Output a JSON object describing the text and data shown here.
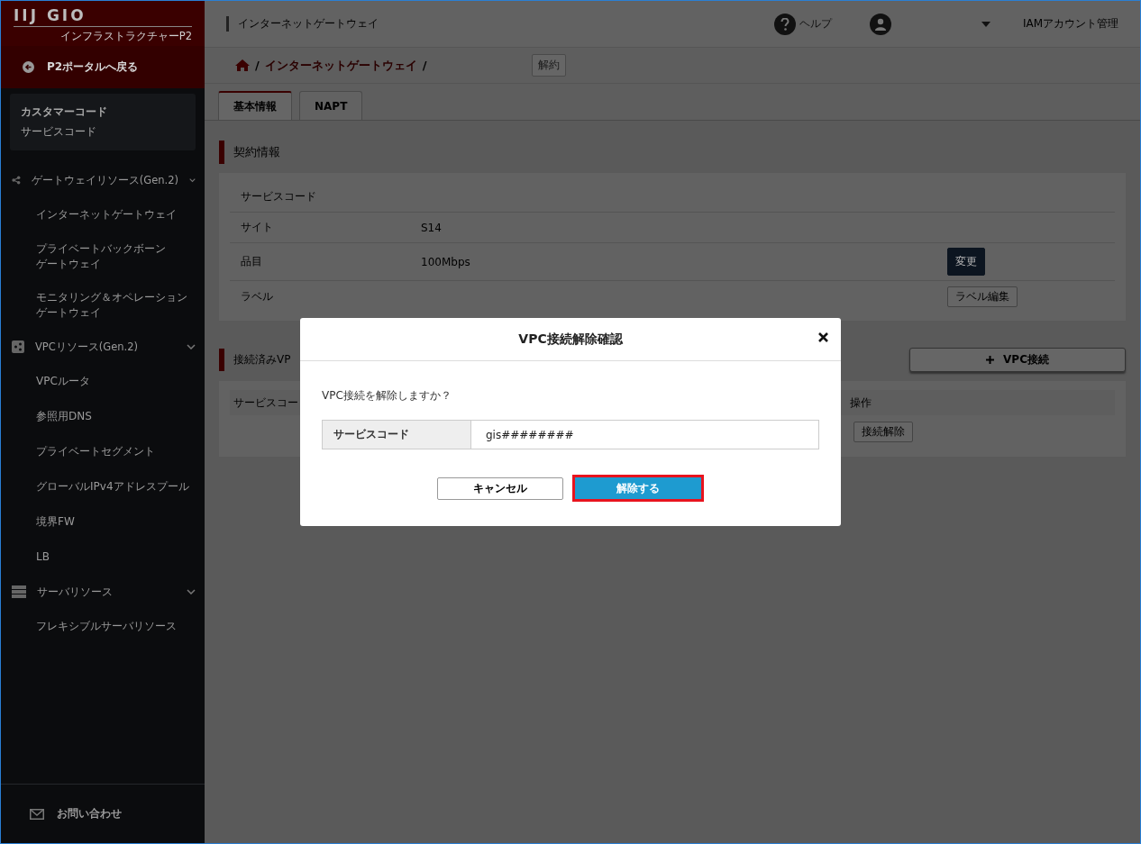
{
  "sidebar": {
    "logo": "IIJ GIO",
    "subtitle": "インフラストラクチャーP2",
    "back_link": "P2ポータルへ戻る",
    "customer": [
      "カスタマーコード",
      "サービスコード"
    ],
    "groups": [
      {
        "label": "ゲートウェイリソース(Gen.2)",
        "kind": "share",
        "expanded": true,
        "children": [
          [
            "インターネットゲートウェイ"
          ],
          [
            "プライベートバックボーン",
            "ゲートウェイ"
          ],
          [
            "モニタリング＆オペレーション",
            "ゲートウェイ"
          ]
        ]
      },
      {
        "label": "VPCリソース(Gen.2)",
        "kind": "share-square",
        "expanded": true,
        "children": [
          [
            "VPCルータ"
          ],
          [
            "参照用DNS"
          ],
          [
            "プライベートセグメント"
          ],
          [
            "グローバルIPv4アドレスプール"
          ],
          [
            "境界FW"
          ],
          [
            "LB"
          ]
        ]
      },
      {
        "label": "サーバリソース",
        "kind": "server",
        "expanded": true,
        "children": [
          [
            "フレキシブルサーバリソース"
          ]
        ]
      }
    ],
    "contact": "お問い合わせ"
  },
  "topbar": {
    "title": "インターネットゲートウェイ",
    "help": "ヘルプ",
    "account_link": "IAMアカウント管理"
  },
  "breadcrumb": {
    "items": [
      {
        "kind": "separator",
        "text": "/"
      },
      {
        "kind": "link",
        "text": "インターネットゲートウェイ"
      },
      {
        "kind": "separator",
        "text": "/"
      }
    ],
    "action": "解約"
  },
  "tabs": [
    {
      "label": "基本情報",
      "selected": true
    },
    {
      "label": "NAPT",
      "selected": false
    }
  ],
  "contract": {
    "title": "契約情報",
    "rows": [
      {
        "label": "サービスコード",
        "kind": "none"
      },
      {
        "label": "サイト",
        "value": "S14",
        "kind": "none"
      },
      {
        "label": "品目",
        "value": "100Mbps",
        "action": "変更",
        "kind": "primary"
      },
      {
        "label": "ラベル",
        "action": "ラベル編集",
        "kind": "default"
      }
    ]
  },
  "connected": {
    "title": "接続済みVP",
    "add_button": "VPC接続",
    "columns": [
      "サービスコー",
      "操作"
    ],
    "row_action": "接続解除"
  },
  "modal": {
    "title": "VPC接続解除確認",
    "message": "VPC接続を解除しますか？",
    "field_label": "サービスコード",
    "field_value": "gis########",
    "cancel": "キャンセル",
    "confirm": "解除する",
    "confirm_highlighted": true
  }
}
